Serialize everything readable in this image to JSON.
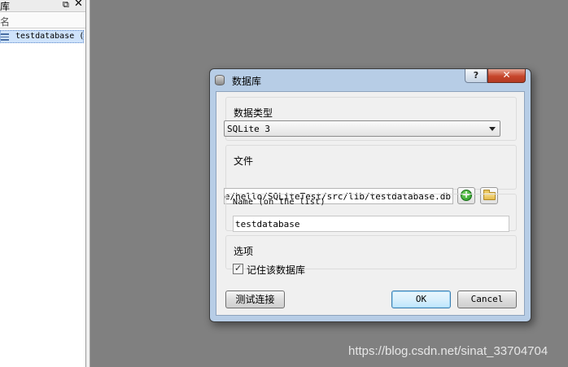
{
  "left_panel": {
    "title": "库",
    "float_icon": "⧉",
    "close_icon": "✕",
    "column_header": "名",
    "items": [
      {
        "label": "testdatabase (S"
      }
    ]
  },
  "dialog": {
    "title": "数据库",
    "help_label": "?",
    "close_label": "✕",
    "db_type": {
      "title": "数据类型",
      "selected": "SQLite 3"
    },
    "file": {
      "title": "文件",
      "value": "lipse/hello/SQLiteTest/src/lib/testdatabase.db",
      "add_icon": "+"
    },
    "name": {
      "title": "Name (on the list)",
      "value": "testdatabase"
    },
    "options": {
      "title": "选项",
      "remember_label": "记住该数据库",
      "remember_checked": true
    },
    "buttons": {
      "test": "测试连接",
      "ok": "OK",
      "cancel": "Cancel"
    }
  },
  "watermark": "https://blog.csdn.net/sinat_33704704"
}
